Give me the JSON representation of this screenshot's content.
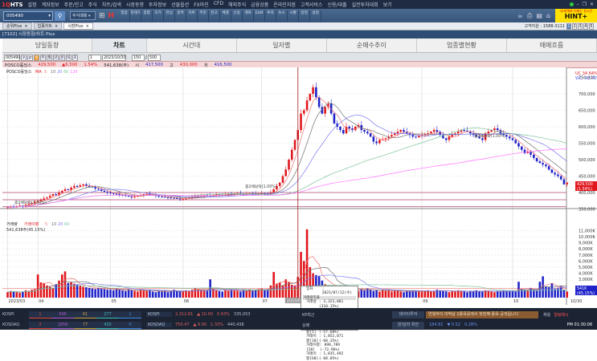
{
  "app": {
    "logo": "HTS",
    "logo_prefix": "1Q"
  },
  "menu": [
    "설정",
    "계좌정보",
    "주문/잔고",
    "주식",
    "차트/검색",
    "시장동향",
    "투자정보",
    "선물옵션",
    "FX마진",
    "CFD",
    "해외주식",
    "금융상품",
    "온라인지점",
    "고객서비스",
    "신용/대출",
    "실전투자대회",
    "보기"
  ],
  "toolbar": {
    "search_value": "005490",
    "dropdown": "주식매매",
    "buttons": [
      "업종",
      "현재가",
      "종합",
      "호가",
      "관심",
      "종목",
      "차트",
      "주문",
      "잔고",
      "체결",
      "신용",
      "계좌",
      "ELW",
      "투자",
      "뉴스",
      "시황",
      "일정",
      "설정"
    ],
    "hint_ad": "국내/해외 이제는 실시간",
    "hint_logo": "HINT+"
  },
  "doc_tabs": [
    "순위Plus",
    "업종차트",
    "시장Plus"
  ],
  "support": "고객지원 : 1588-3111",
  "pages": [
    "1",
    "2",
    "3",
    "4",
    "5"
  ],
  "window_title": "[7102] 시장동향/차트 Plus",
  "tabs": [
    "당일동향",
    "차트",
    "시간대",
    "일자별",
    "순매수추이",
    "업종별현황",
    "매매흐름"
  ],
  "controls": {
    "code": "005490",
    "periods": [
      "일",
      "주",
      "월",
      "년",
      "분",
      "틱",
      "초"
    ],
    "unit": "1",
    "date": "2023/10/30",
    "count": "150",
    "total": "500"
  },
  "info": {
    "name": "POSCO홀딩스",
    "price": "429,500",
    "change": "▲6,500",
    "rate": "1.54%",
    "volume": "541,638(주)",
    "open_label": "시",
    "open": "417,500",
    "high_label": "고",
    "high": "430,000",
    "low_label": "저",
    "low": "416,500"
  },
  "legend": {
    "price": "POSCO홀딩스",
    "ma_label": "MA",
    "ma": [
      "5",
      "10",
      "20",
      "60",
      "120"
    ],
    "vol": "거래량",
    "vol_ma": "거래이평",
    "vol_ma_periods": [
      "5",
      "10",
      "20",
      "60"
    ],
    "vol_value": "541,638주(45.15%)"
  },
  "right_tags": {
    "uc": "UC 34.64%",
    "wc": "WC -43.70%",
    "price": "429,500",
    "price_rate": "(1.54%)",
    "vol": "541K",
    "vol_rate": "(45.15%)"
  },
  "annotations": [
    "종2배당락(1.00%)",
    "종2배당락(1.00%)",
    "종2배당락(1.00%)"
  ],
  "crosshair_date": "2023/07/12",
  "tooltip": {
    "date_label": "일자",
    "date": ": 2023/07/12(수)",
    "sec1": "거래량지표",
    "rows1": [
      [
        "거래량",
        ": 3,323,081 (310.15%)"
      ],
      [
        "거래대금",
        ": 1,373,517(백만)"
      ]
    ],
    "sec2": "거래량 이동평균",
    "rows2": [
      [
        "거래이평[5]",
        ": 1,407,453 (-57.68%)"
      ],
      [
        "거래이평[10]",
        ": 1,852,071 (-68.35%)"
      ],
      [
        "거래이평[20]",
        ": 898,789 (-72.96%)"
      ],
      [
        "거래이평[60]",
        ": 1,835,492 (-68.85%)"
      ]
    ]
  },
  "status": {
    "row1": {
      "name": "KOSPI",
      "breadth": [
        "1",
        "596",
        "61",
        "277",
        "1"
      ],
      "index": "KOSPI",
      "value": "2,312.81",
      "change": "▲ 10.00",
      "rate": "0.43%",
      "vol": "335,053",
      "extra": "KP최근",
      "label": "데이터투자",
      "ticker": "연월하이 마벅날 2종목중에서 첫번째 종목 공개됩니다",
      "btn1": "채용",
      "btn2": "알림메시"
    },
    "row2": {
      "name": "KOSDAQ",
      "breadth": [
        "2",
        "1858",
        "77",
        "435",
        "0"
      ],
      "index": "KOSDAQ",
      "value": "750.47",
      "change": "▲ 9.90",
      "rate": "1.33%",
      "vol": "440,438",
      "extra": "상배",
      "label": "원/달러 위안",
      "fx": "184.82",
      "fx_change": "▼ 0.52",
      "fx_rate": "0.28%",
      "clock": "PM 01:30:08"
    }
  },
  "colors": {
    "up": "#e0161c",
    "down": "#1e22c8",
    "ma5": "#f07070",
    "ma10": "#707070",
    "ma20": "#7b7bf0",
    "ma60": "#7cc49a",
    "ma120": "#ff70ff"
  },
  "chart_data": {
    "type": "candlestick",
    "price_axis": [
      "750,000",
      "700,000",
      "650,000",
      "600,000",
      "550,000",
      "500,000",
      "450,000",
      "400,000",
      "350,000"
    ],
    "volume_axis": [
      "11,000K",
      "10,000K",
      "9,000K",
      "8,000K",
      "7,000K",
      "6,000K",
      "5,000K",
      "4,000K",
      "3,000K"
    ],
    "month_ticks": [
      {
        "i": 0,
        "label": "2023/03"
      },
      {
        "i": 10,
        "label": "04"
      },
      {
        "i": 34,
        "label": "05"
      },
      {
        "i": 58,
        "label": "06"
      },
      {
        "i": 84,
        "label": "07"
      },
      {
        "i": 137,
        "label": "09"
      },
      {
        "i": 167,
        "label": "10"
      },
      {
        "i": 185,
        "label": "10/30"
      }
    ],
    "close_k": [
      355,
      357,
      356,
      358,
      360,
      358,
      362,
      365,
      368,
      372,
      375,
      378,
      382,
      385,
      390,
      395,
      392,
      400,
      405,
      410,
      408,
      415,
      420,
      418,
      422,
      425,
      420,
      418,
      416,
      412,
      410,
      405,
      402,
      400,
      398,
      396,
      395,
      393,
      392,
      390,
      388,
      386,
      388,
      390,
      392,
      395,
      396,
      394,
      392,
      390,
      388,
      387,
      386,
      385,
      384,
      383,
      382,
      380,
      380,
      382,
      385,
      386,
      388,
      389,
      390,
      392,
      391,
      390,
      392,
      394,
      393,
      392,
      394,
      396,
      395,
      397,
      398,
      396,
      395,
      397,
      398,
      396,
      395,
      396,
      398,
      397,
      396,
      400,
      410,
      420,
      430,
      450,
      470,
      500,
      530,
      560,
      590,
      640,
      650,
      680,
      700,
      720,
      690,
      660,
      640,
      660,
      670,
      640,
      610,
      600,
      590,
      580,
      600,
      595,
      590,
      600,
      605,
      590,
      585,
      580,
      570,
      555,
      550,
      560,
      562,
      565,
      570,
      575,
      580,
      585,
      590,
      585,
      580,
      575,
      570,
      568,
      572,
      575,
      578,
      580,
      585,
      590,
      585,
      575,
      565,
      560,
      570,
      575,
      580,
      585,
      590,
      588,
      585,
      580,
      575,
      570,
      565,
      560,
      580,
      585,
      590,
      595,
      590,
      580,
      575,
      570,
      565,
      560,
      550,
      540,
      530,
      520,
      525,
      515,
      505,
      495,
      490,
      485,
      480,
      470,
      460,
      455,
      450,
      440,
      425,
      430
    ],
    "volume_k": [
      900,
      1100,
      1000,
      900,
      800,
      1000,
      1200,
      1100,
      1300,
      1400,
      3800,
      2500,
      2400,
      2000,
      1800,
      1600,
      2200,
      2800,
      3800,
      4300,
      2400,
      2500,
      2300,
      2100,
      2000,
      1800,
      1700,
      1600,
      1500,
      1400,
      1600,
      1500,
      1400,
      1300,
      1300,
      1200,
      1500,
      1300,
      1200,
      1100,
      1400,
      1200,
      1100,
      1000,
      1300,
      1200,
      1100,
      1200,
      1000,
      900,
      1100,
      1000,
      1200,
      900,
      1000,
      1300,
      1100,
      1000,
      1000,
      1200,
      1100,
      1300,
      1500,
      1400,
      1300,
      1200,
      1100,
      3000,
      1400,
      1200,
      1100,
      1000,
      1200,
      1100,
      1300,
      1200,
      1100,
      1000,
      1200,
      1100,
      1300,
      1100,
      1200,
      1400,
      1500,
      1300,
      1400,
      2000,
      4200,
      2300,
      2500,
      2000,
      3000,
      2600,
      2100,
      2000,
      3400,
      7500,
      6000,
      11200,
      5000,
      4000,
      3700,
      3500,
      2800,
      2200,
      2000,
      1800,
      1700,
      1600,
      1500,
      1400,
      1400,
      1300,
      1200,
      1300,
      1100,
      1400,
      1200,
      1500,
      1300,
      1100,
      1200,
      1000,
      1300,
      1100,
      1200,
      1000,
      1100,
      1200,
      1000,
      900,
      1100,
      1000,
      1200,
      1100,
      1000,
      1000,
      1100,
      1200,
      1000,
      1100,
      1300,
      1200,
      1100,
      1000,
      900,
      1100,
      1000,
      1200,
      1100,
      1000,
      900,
      1100,
      1000,
      1200,
      1100,
      1000,
      1200,
      1100,
      1000,
      900,
      1100,
      1000,
      1200,
      1100,
      1000,
      1200,
      1000,
      2600,
      1400,
      1300,
      1100,
      1500,
      1300,
      1200,
      2600,
      3500,
      1800,
      1700,
      2300,
      1400,
      1500,
      1900,
      1300,
      1000
    ],
    "support_lines_k": [
      400,
      378,
      357
    ],
    "crosshair_index": 96
  }
}
